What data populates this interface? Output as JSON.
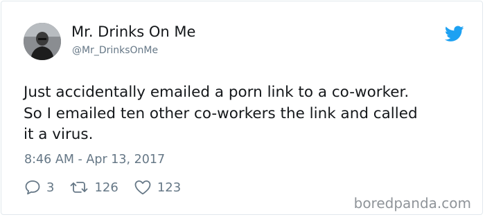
{
  "tweet": {
    "author_name": "Mr. Drinks On Me",
    "author_handle": "@Mr_DrinksOnMe",
    "text_lines": [
      "Just accidentally emailed a porn link to a co-worker.",
      "So I emailed ten other co-workers the link and called",
      "it a virus."
    ],
    "timestamp": "8:46 AM - Apr 13, 2017",
    "replies": "3",
    "retweets": "126",
    "likes": "123"
  },
  "icons": {
    "brand": "twitter-bird-icon",
    "reply": "reply-icon",
    "retweet": "retweet-icon",
    "like": "heart-icon"
  },
  "colors": {
    "twitter_blue": "#1da1f2",
    "secondary_text": "#657786",
    "primary_text": "#14171a",
    "border": "#e1e8ed"
  },
  "watermark": "boredpanda.com"
}
